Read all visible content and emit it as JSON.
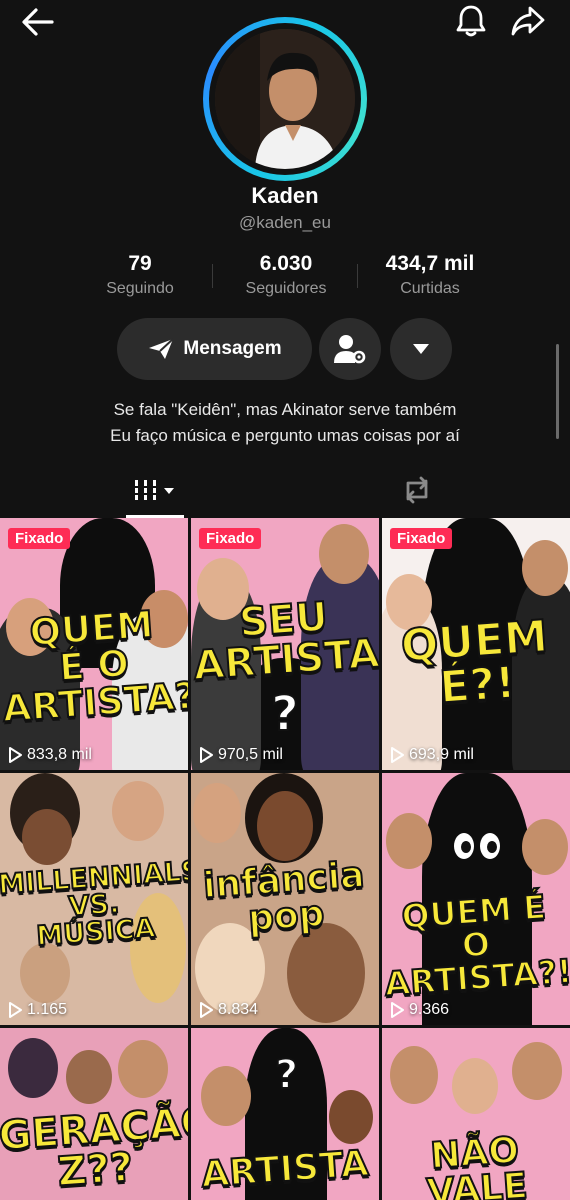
{
  "profile": {
    "name": "Kaden",
    "handle": "@kaden_eu",
    "bio_line1": "Se fala \"Keidên\", mas Akinator serve também",
    "bio_line2": "Eu faço música e pergunto umas coisas por aí"
  },
  "stats": [
    {
      "value": "79",
      "label": "Seguindo"
    },
    {
      "value": "6.030",
      "label": "Seguidores"
    },
    {
      "value": "434,7 mil",
      "label": "Curtidas"
    }
  ],
  "actions": {
    "message_label": "Mensagem"
  },
  "icons": {
    "back": "arrow-left-icon",
    "notifications": "bell-icon",
    "share": "share-icon",
    "message": "send-icon",
    "add_friend": "user-settings-icon",
    "more": "dropdown-triangle-icon",
    "videos_tab": "grid-icon",
    "reposts_tab": "repost-icon",
    "views": "play-icon"
  },
  "colors": {
    "background": "#121212",
    "pinned_badge": "#fe2c55",
    "ring": "#19c6e8",
    "thumb_text": "#f7e83a",
    "thumb_pink": "#f4a9c4"
  },
  "videos": [
    {
      "pinned": "Fixado",
      "title": "QUEM É O ARTISTA??",
      "views": "833,8 mil"
    },
    {
      "pinned": "Fixado",
      "title": "SEU ARTISTA",
      "views": "970,5 mil"
    },
    {
      "pinned": "Fixado",
      "title": "QUEM É?!",
      "views": "693,9 mil"
    },
    {
      "title": "MILLENNIALS VS. MÚSICA",
      "views": "1.165"
    },
    {
      "title": "infância pop",
      "views": "8.834"
    },
    {
      "title": "QUEM É O ARTISTA?!",
      "views": "9.366"
    },
    {
      "title": "GERAÇÃO Z??",
      "views": ""
    },
    {
      "title": "ARTISTA",
      "views": ""
    },
    {
      "title": "NÃO VALE",
      "views": ""
    }
  ]
}
